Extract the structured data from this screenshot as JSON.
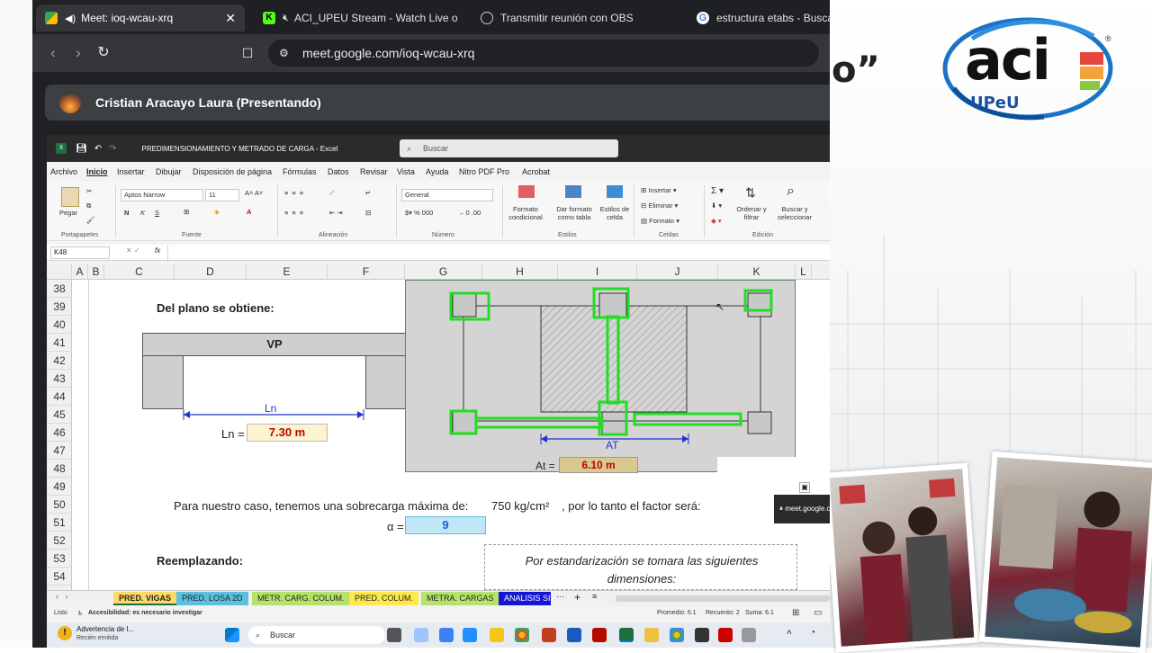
{
  "browser": {
    "tabs": [
      {
        "label": "Meet: ioq-wcau-xrq",
        "icon": "meet-icon",
        "color": "#34a853"
      },
      {
        "label": "ACI_UPEU Stream - Watch Live on",
        "icon": "kick-icon",
        "color": "#53fc18"
      },
      {
        "label": "Transmitir reunión con OBS",
        "icon": "globe-icon",
        "color": "#cccccc"
      },
      {
        "label": "estructura etabs - Buscar",
        "icon": "google-icon",
        "color": "#4285f4"
      }
    ],
    "url": "meet.google.com/ioq-wcau-xrq"
  },
  "meet": {
    "presenter": "Cristian Aracayo Laura (Presentando)",
    "popup": "meet.google.c"
  },
  "slide": {
    "partial_text": "o”"
  },
  "logo": {
    "main": "aci",
    "sub": "UPeU",
    "registered": "®"
  },
  "excel": {
    "title": "PREDIMENSIONAMIENTO Y METRADO DE CARGA  -  Excel",
    "search_placeholder": "Buscar",
    "menu": [
      "Archivo",
      "Inicio",
      "Insertar",
      "Dibujar",
      "Disposición de página",
      "Fórmulas",
      "Datos",
      "Revisar",
      "Vista",
      "Ayuda",
      "Nitro PDF Pro",
      "Acrobat"
    ],
    "ribbon": {
      "paste": "Pegar",
      "font_name": "Aptos Narrow",
      "font_size": "11",
      "number_format": "General",
      "cond_format": "Formato condicional",
      "table_format": "Dar formato como tabla",
      "cell_styles": "Estilos de celda",
      "insert": "Insertar",
      "delete": "Eliminar",
      "format": "Formato",
      "sort": "Ordenar y filtrar",
      "find": "Buscar y seleccionar",
      "groups": [
        "Portapapeles",
        "Fuente",
        "Alineación",
        "Número",
        "Estilos",
        "Celdas",
        "Edición"
      ]
    },
    "name_box": "K48",
    "fx": "fx",
    "columns": [
      "A",
      "B",
      "C",
      "D",
      "E",
      "F",
      "G",
      "H",
      "I",
      "J",
      "K",
      "L"
    ],
    "rows": [
      "38",
      "39",
      "40",
      "41",
      "42",
      "43",
      "44",
      "45",
      "46",
      "47",
      "48",
      "49",
      "50",
      "51",
      "52",
      "53",
      "54"
    ],
    "cells": {
      "del_plano": "Del plano se obtiene:",
      "vp": "VP",
      "ln_label": "Ln",
      "ln_eq": "Ln =",
      "ln_val": "7.30 m",
      "at_label": "AT",
      "at_eq": "At =",
      "at_val": "6.10 m",
      "sobrecarga": "Para nuestro caso, tenemos una sobrecarga máxima de:",
      "sobrecarga_val": "750 kg/cm²",
      "factor": ", por lo tanto el factor será:",
      "alpha_eq": "α =",
      "alpha_val": "9",
      "reemplazando": "Reemplazando:",
      "estandar1": "Por estandarización se tomara las siguientes",
      "estandar2": "dimensiones:"
    },
    "sheets": [
      {
        "label": "PRED. VIGAS",
        "color": "#ffd966",
        "active": true
      },
      {
        "label": "PRED. LOSA 2D",
        "color": "#5bc0de"
      },
      {
        "label": "METR. CARG. COLUM.",
        "color": "#b6e26b"
      },
      {
        "label": "PRED. COLUM.",
        "color": "#ffe94a"
      },
      {
        "label": "METRA. CARGAS",
        "color": "#b6e26b"
      },
      {
        "label": "ANALISIS SIS",
        "color": "#1515d6"
      }
    ],
    "status": {
      "ready": "Listo",
      "accessibility": "Accesibilidad: es necesario investigar",
      "avg": "Promedio: 6.1",
      "count": "Recuento: 2",
      "sum": "Suma: 6.1"
    }
  },
  "taskbar": {
    "notif_title": "Advertencia de l...",
    "notif_sub": "Recién emitida",
    "search": "Buscar"
  }
}
